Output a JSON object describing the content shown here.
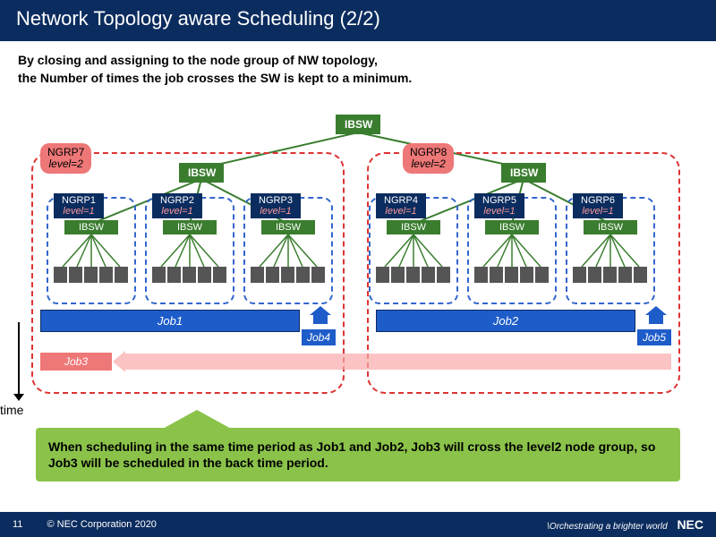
{
  "header": {
    "title": "Network Topology aware Scheduling (2/2)"
  },
  "subhead": {
    "line1": "By closing and assigning to the node group of NW topology,",
    "line2": "the Number of times the job crosses the SW is kept to a minimum."
  },
  "labels": {
    "ibsw": "IBSW",
    "ngrp7": "NGRP7",
    "ngrp8": "NGRP8",
    "level2": "level=2",
    "level1": "level=1",
    "ngrp1": "NGRP1",
    "ngrp2": "NGRP2",
    "ngrp3": "NGRP3",
    "ngrp4": "NGRP4",
    "ngrp5": "NGRP5",
    "ngrp6": "NGRP6",
    "job1": "Job1",
    "job2": "Job2",
    "job3": "Job3",
    "job4": "Job4",
    "job5": "Job5",
    "time": "time"
  },
  "callout": {
    "text": "When scheduling in the same time period as Job1 and Job2, Job3 will cross the level2 node group, so Job3 will be scheduled in the back time period."
  },
  "footer": {
    "page": "11",
    "copyright": "© NEC Corporation 2020",
    "tagline": "\\Orchestrating a brighter world",
    "brand": "NEC"
  },
  "colors": {
    "navy": "#0b2c5e",
    "green": "#3a7d2f",
    "pink": "#e77",
    "blue": "#1e5cc9",
    "callout": "#8bc34a"
  }
}
